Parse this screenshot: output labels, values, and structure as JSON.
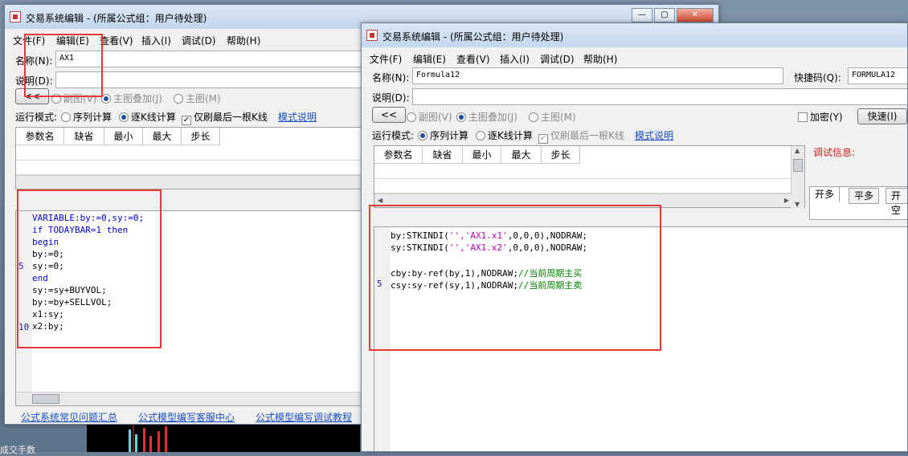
{
  "left_window": {
    "title": "交易系统编辑 - (所属公式组：用户待处理)",
    "menu": [
      "文件(F)",
      "编辑(E)",
      "查看(V)",
      "插入(I)",
      "调试(D)",
      "帮助(H)"
    ],
    "name_label": "名称(N):",
    "name_value": "AX1",
    "desc_label": "说明(D):",
    "collapse_label": "<<",
    "chart_opts": [
      "副图(V)",
      "主图叠加(J)",
      "主图(M)"
    ],
    "run_mode_label": "运行模式:",
    "run_opts": [
      "序列计算",
      "逐K线计算",
      "仅刷最后一根K线"
    ],
    "mode_help": "模式说明",
    "param_headers": [
      "参数名",
      "缺省",
      "最小",
      "最大",
      "步长"
    ],
    "code_lines": [
      "VARIABLE:by:=0,sy:=0;",
      "if TODAYBAR=1 then",
      "begin",
      "by:=0;",
      "sy:=0;",
      "end",
      "sy:=sy+BUYVOL;",
      "by:=by+SELLVOL;",
      "x1:sy;",
      "x2:by;"
    ],
    "line_numbers": [
      "5",
      "10"
    ],
    "footer_links": [
      "公式系统常见问题汇总",
      "公式模型编写客服中心",
      "公式模型编写调试教程"
    ]
  },
  "right_window": {
    "title": "交易系统编辑 - (所属公式组：用户待处理)",
    "menu": [
      "文件(F)",
      "编辑(E)",
      "查看(V)",
      "插入(I)",
      "调试(D)",
      "帮助(H)"
    ],
    "name_label": "名称(N):",
    "name_value": "Formula12",
    "shortcut_label": "快捷码(Q):",
    "shortcut_value": "FORMULA12",
    "desc_label": "说明(D):",
    "collapse_label": "<<",
    "chart_opts": [
      "副图(V)",
      "主图叠加(J)",
      "主图(M)"
    ],
    "encrypt_label": "加密(Y)",
    "fast_button": "快速(I)",
    "run_mode_label": "运行模式:",
    "run_opts": [
      "序列计算",
      "逐K线计算",
      "仅刷最后一根K线"
    ],
    "mode_help": "模式说明",
    "param_headers": [
      "参数名",
      "缺省",
      "最小",
      "最大",
      "步长"
    ],
    "debug_label": "调试信息:",
    "tabs": [
      "开多",
      "平多",
      "开空"
    ],
    "code": {
      "l1a": "by:STKINDI(",
      "l1s": "'','AX1.x1'",
      "l1b": ",0,0,0),NODRAW;",
      "l2a": "sy:STKINDI(",
      "l2s": "'','AX1.x2'",
      "l2b": ",0,0,0),NODRAW;",
      "l4a": "cby:by-ref(by,1),NODRAW;",
      "l4c": "//当前周期主买",
      "l5a": "csy:sy-ref(sy,1),NODRAW;",
      "l5c": "//当前周期主卖"
    },
    "line_number": "5"
  },
  "bg_text": "成交手数"
}
